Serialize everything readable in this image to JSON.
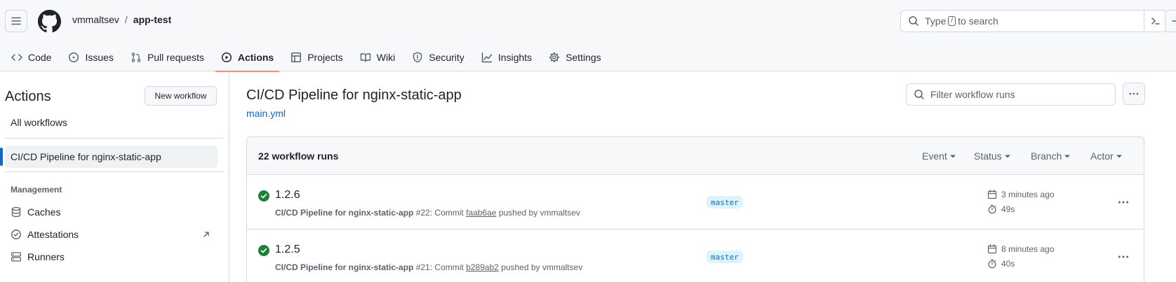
{
  "header": {
    "owner": "vmmaltsev",
    "separator": "/",
    "repo": "app-test",
    "search": {
      "before": "Type",
      "key": "/",
      "after": "to search"
    }
  },
  "repo_nav": {
    "tabs": [
      {
        "label": "Code",
        "icon": "code-icon",
        "selected": false
      },
      {
        "label": "Issues",
        "icon": "issue-icon",
        "selected": false
      },
      {
        "label": "Pull requests",
        "icon": "pull-request-icon",
        "selected": false
      },
      {
        "label": "Actions",
        "icon": "play-icon",
        "selected": true
      },
      {
        "label": "Projects",
        "icon": "table-icon",
        "selected": false
      },
      {
        "label": "Wiki",
        "icon": "book-icon",
        "selected": false
      },
      {
        "label": "Security",
        "icon": "shield-icon",
        "selected": false
      },
      {
        "label": "Insights",
        "icon": "graph-icon",
        "selected": false
      },
      {
        "label": "Settings",
        "icon": "gear-icon",
        "selected": false
      }
    ]
  },
  "sidebar": {
    "title": "Actions",
    "new_workflow": "New workflow",
    "all_workflows": "All workflows",
    "active_workflow": "CI/CD Pipeline for nginx-static-app",
    "management_label": "Management",
    "management_items": [
      {
        "label": "Caches",
        "icon": "database-icon"
      },
      {
        "label": "Attestations",
        "icon": "verified-icon"
      },
      {
        "label": "Runners",
        "icon": "server-icon"
      }
    ]
  },
  "main": {
    "workflow_title": "CI/CD Pipeline for nginx-static-app",
    "workflow_file": "main.yml",
    "filter_placeholder": "Filter workflow runs",
    "runs_count": "22 workflow runs",
    "filters": [
      "Event",
      "Status",
      "Branch",
      "Actor"
    ],
    "runs": [
      {
        "name": "1.2.6",
        "workflow": "CI/CD Pipeline for nginx-static-app",
        "number": "#22",
        "commit_prefix": ": Commit",
        "sha": "faab6ae",
        "pushed_by": "pushed by vmmaltsev",
        "branch": "master",
        "time": "3 minutes ago",
        "duration": "49s",
        "status": "success"
      },
      {
        "name": "1.2.5",
        "workflow": "CI/CD Pipeline for nginx-static-app",
        "number": "#21",
        "commit_prefix": ": Commit",
        "sha": "b289ab2",
        "pushed_by": "pushed by vmmaltsev",
        "branch": "master",
        "time": "8 minutes ago",
        "duration": "40s",
        "status": "success"
      }
    ]
  },
  "colors": {
    "accent": "#0969da",
    "success": "#1a7f37",
    "selected_tab_underline": "#fd8c73",
    "branch_bg": "#ddf4ff"
  }
}
